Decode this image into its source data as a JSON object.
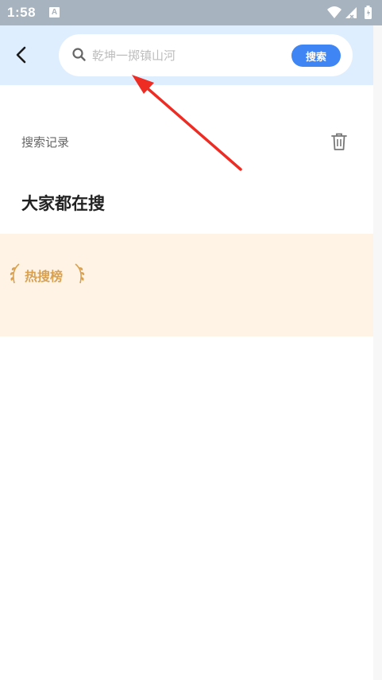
{
  "status_bar": {
    "time": "1:58",
    "notification_icon": "A"
  },
  "header": {
    "back_icon": "chevron-left-icon",
    "search_placeholder": "乾坤一掷镇山河",
    "search_button": "搜索"
  },
  "history": {
    "label": "搜索记录",
    "clear_icon": "trash-icon"
  },
  "everyone_searching": {
    "title": "大家都在搜"
  },
  "hot_list": {
    "badge": "热搜榜"
  },
  "colors": {
    "header_bg": "#dfeefe",
    "accent": "#3f86f4",
    "hot_bg": "#fff3e6",
    "hot_text": "#d9a14f",
    "annotation_arrow": "#ee2c24"
  }
}
